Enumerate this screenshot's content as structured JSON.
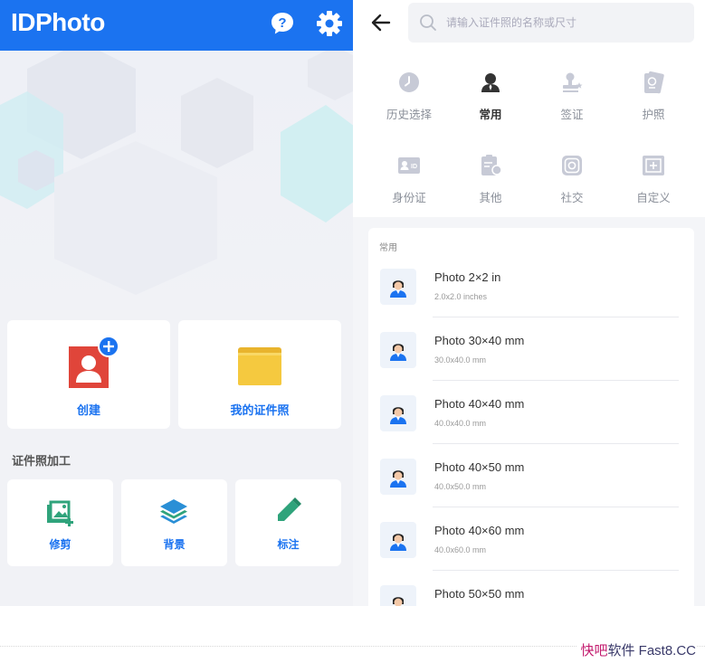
{
  "app": {
    "title": "IDPhoto"
  },
  "home": {
    "create_label": "创建",
    "my_photos_label": "我的证件照",
    "section_title": "证件照加工",
    "tools": [
      {
        "label": "修剪",
        "icon": "crop-image-icon"
      },
      {
        "label": "背景",
        "icon": "layers-icon"
      },
      {
        "label": "标注",
        "icon": "pencil-icon"
      }
    ]
  },
  "search": {
    "placeholder": "请输入证件照的名称或尺寸"
  },
  "categories": [
    {
      "label": "历史选择",
      "icon": "clock-icon"
    },
    {
      "label": "常用",
      "icon": "person-icon",
      "active": true
    },
    {
      "label": "签证",
      "icon": "stamp-icon"
    },
    {
      "label": "护照",
      "icon": "passport-icon"
    },
    {
      "label": "身份证",
      "icon": "id-card-icon"
    },
    {
      "label": "其他",
      "icon": "document-icon"
    },
    {
      "label": "社交",
      "icon": "instagram-icon"
    },
    {
      "label": "自定义",
      "icon": "custom-frame-icon"
    }
  ],
  "list": {
    "heading": "常用",
    "items": [
      {
        "title": "Photo 2×2 in",
        "subtitle": "2.0x2.0 inches"
      },
      {
        "title": "Photo 30×40 mm",
        "subtitle": "30.0x40.0 mm"
      },
      {
        "title": "Photo 40×40 mm",
        "subtitle": "40.0x40.0 mm"
      },
      {
        "title": "Photo 40×50 mm",
        "subtitle": "40.0x50.0 mm"
      },
      {
        "title": "Photo 40×60 mm",
        "subtitle": "40.0x60.0 mm"
      },
      {
        "title": "Photo 50×50 mm",
        "subtitle": ""
      }
    ]
  },
  "watermark": {
    "part1": "快吧",
    "part2": "软件 Fast8.CC"
  },
  "colors": {
    "brand": "#1b73f0",
    "accent_red": "#e0453a",
    "folder": "#f5c23c",
    "tool_green": "#2fa37b",
    "tool_blue": "#2a8fd6"
  }
}
